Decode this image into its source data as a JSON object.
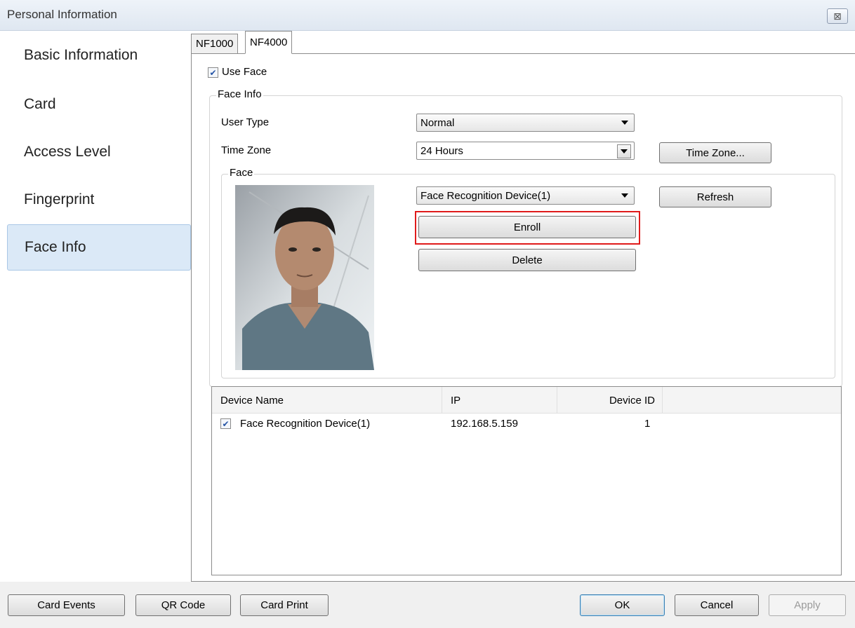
{
  "window": {
    "title": "Personal Information",
    "close_symbol": "⊠"
  },
  "sidebar": {
    "items": [
      {
        "label": "Basic Information",
        "active": false
      },
      {
        "label": "Card",
        "active": false
      },
      {
        "label": "Access Level",
        "active": false
      },
      {
        "label": "Fingerprint",
        "active": false
      },
      {
        "label": "Face Info",
        "active": true
      }
    ]
  },
  "tabs": [
    {
      "label": "NF1000",
      "active": false
    },
    {
      "label": "NF4000",
      "active": true
    }
  ],
  "use_face": {
    "label": "Use Face",
    "checked": true
  },
  "face_info": {
    "legend": "Face Info",
    "user_type_label": "User Type",
    "user_type_value": "Normal",
    "time_zone_label": "Time Zone",
    "time_zone_value": "24 Hours",
    "time_zone_button": "Time Zone..."
  },
  "face": {
    "legend": "Face",
    "device_select": "Face Recognition Device(1)",
    "refresh_button": "Refresh",
    "enroll_button": "Enroll",
    "delete_button": "Delete"
  },
  "device_list": {
    "columns": [
      "Device Name",
      "IP",
      "Device ID"
    ],
    "rows": [
      {
        "checked": true,
        "name": "Face Recognition Device(1)",
        "ip": "192.168.5.159",
        "id": "1"
      }
    ]
  },
  "footer": {
    "card_events": "Card Events",
    "qr_code": "QR Code",
    "card_print": "Card Print",
    "ok": "OK",
    "cancel": "Cancel",
    "apply": "Apply"
  },
  "colors": {
    "highlight": "#e01b1b",
    "active_item": "#dbe9f7"
  }
}
